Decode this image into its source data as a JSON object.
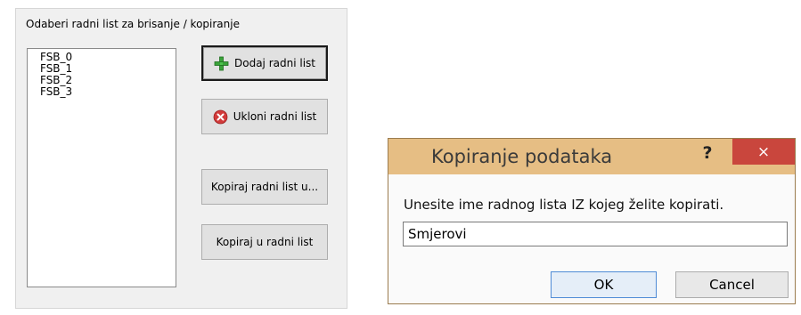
{
  "panel": {
    "label": "Odaberi radni list za brisanje / kopiranje",
    "sheets": [
      "FSB_0",
      "FSB_1",
      "FSB_2",
      "FSB_3"
    ],
    "buttons": {
      "add": "Dodaj radni list",
      "remove": "Ukloni radni list",
      "copy_to": "Kopiraj radni list u...",
      "copy_into": "Kopiraj u radni list"
    }
  },
  "dialog": {
    "title": "Kopiranje podataka",
    "help": "?",
    "close": "×",
    "prompt": "Unesite ime radnog lista IZ kojeg želite kopirati.",
    "input_value": "Smjerovi",
    "ok": "OK",
    "cancel": "Cancel"
  },
  "icons": {
    "add": "green-plus-icon",
    "remove": "red-x-circle-icon"
  },
  "colors": {
    "titlebar": "#e6be84",
    "close": "#c9463d",
    "ok_border": "#4f8bd6"
  }
}
